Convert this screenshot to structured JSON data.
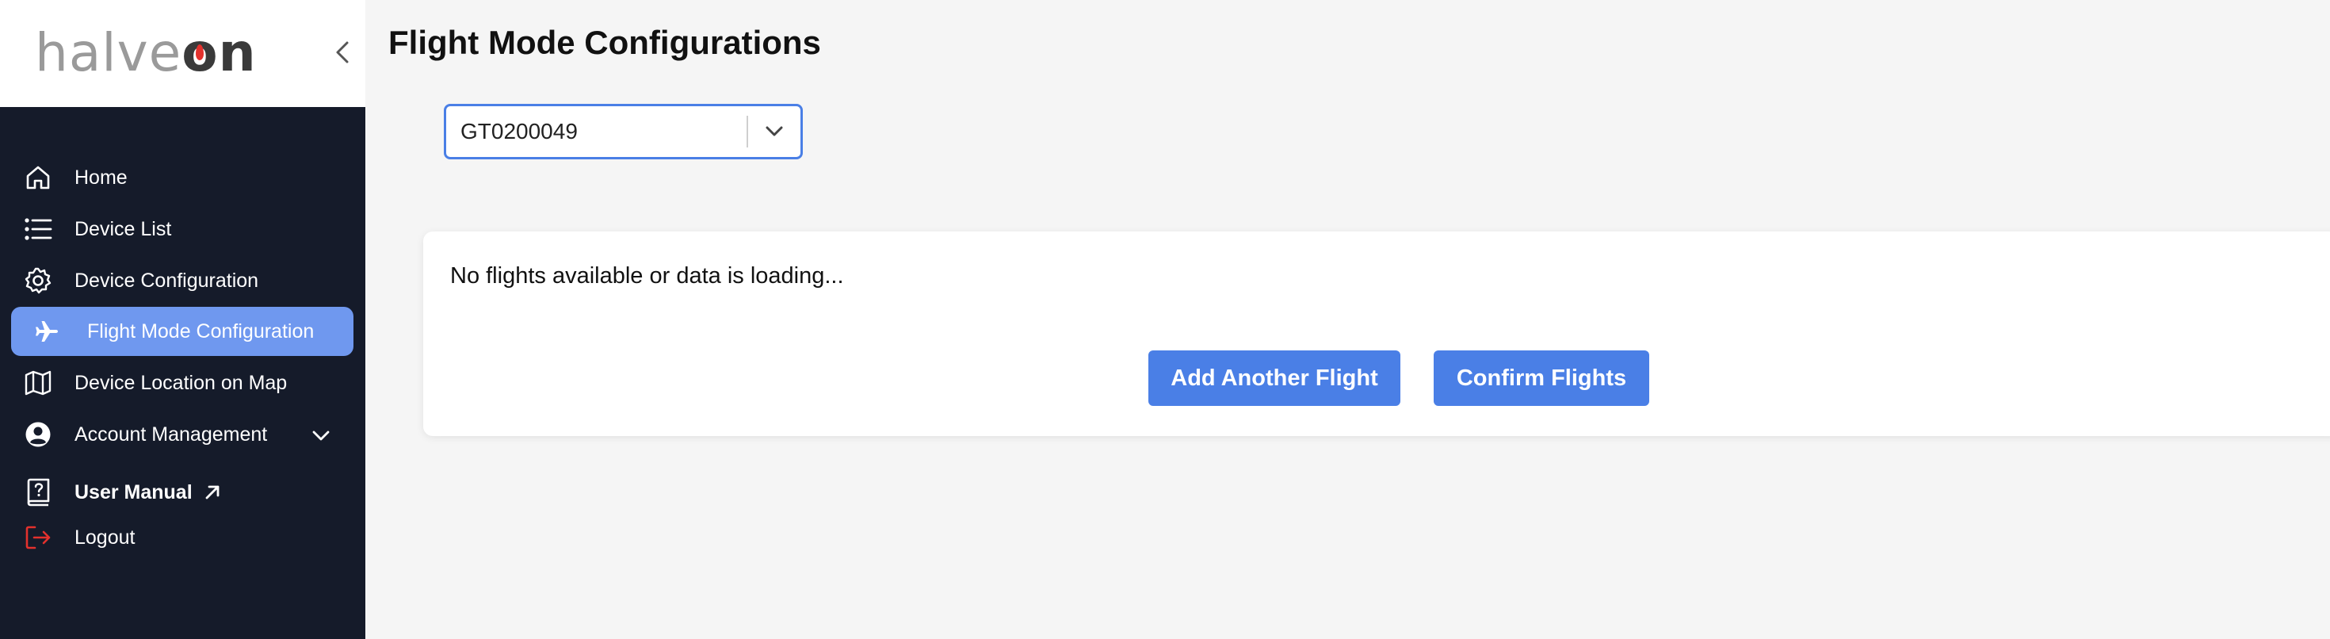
{
  "brand": {
    "logo_light": "halve",
    "logo_o": "o",
    "logo_dark": "n",
    "accent_color": "#e3312d"
  },
  "sidebar": {
    "collapse_icon": "chevron-left-icon",
    "items": [
      {
        "label": "Home",
        "icon": "home-icon"
      },
      {
        "label": "Device List",
        "icon": "list-icon"
      },
      {
        "label": "Device Configuration",
        "icon": "gear-icon"
      },
      {
        "label": "Flight Mode Configuration",
        "icon": "airplane-icon",
        "active": true
      },
      {
        "label": "Device Location on Map",
        "icon": "map-icon"
      },
      {
        "label": "Account Management",
        "icon": "user-circle-icon",
        "expandable": true
      },
      {
        "label": "User Manual",
        "icon": "manual-icon",
        "external": true
      },
      {
        "label": "Logout",
        "icon": "logout-icon"
      }
    ],
    "bg_color": "#151b2a",
    "active_color": "#6f98ef"
  },
  "main": {
    "title": "Flight Mode Configurations",
    "device_select": {
      "value": "GT0200049"
    },
    "panel": {
      "message": "No flights available or data is loading...",
      "add_button": "Add Another Flight",
      "confirm_button": "Confirm Flights"
    },
    "button_color": "#4a7fe6"
  }
}
